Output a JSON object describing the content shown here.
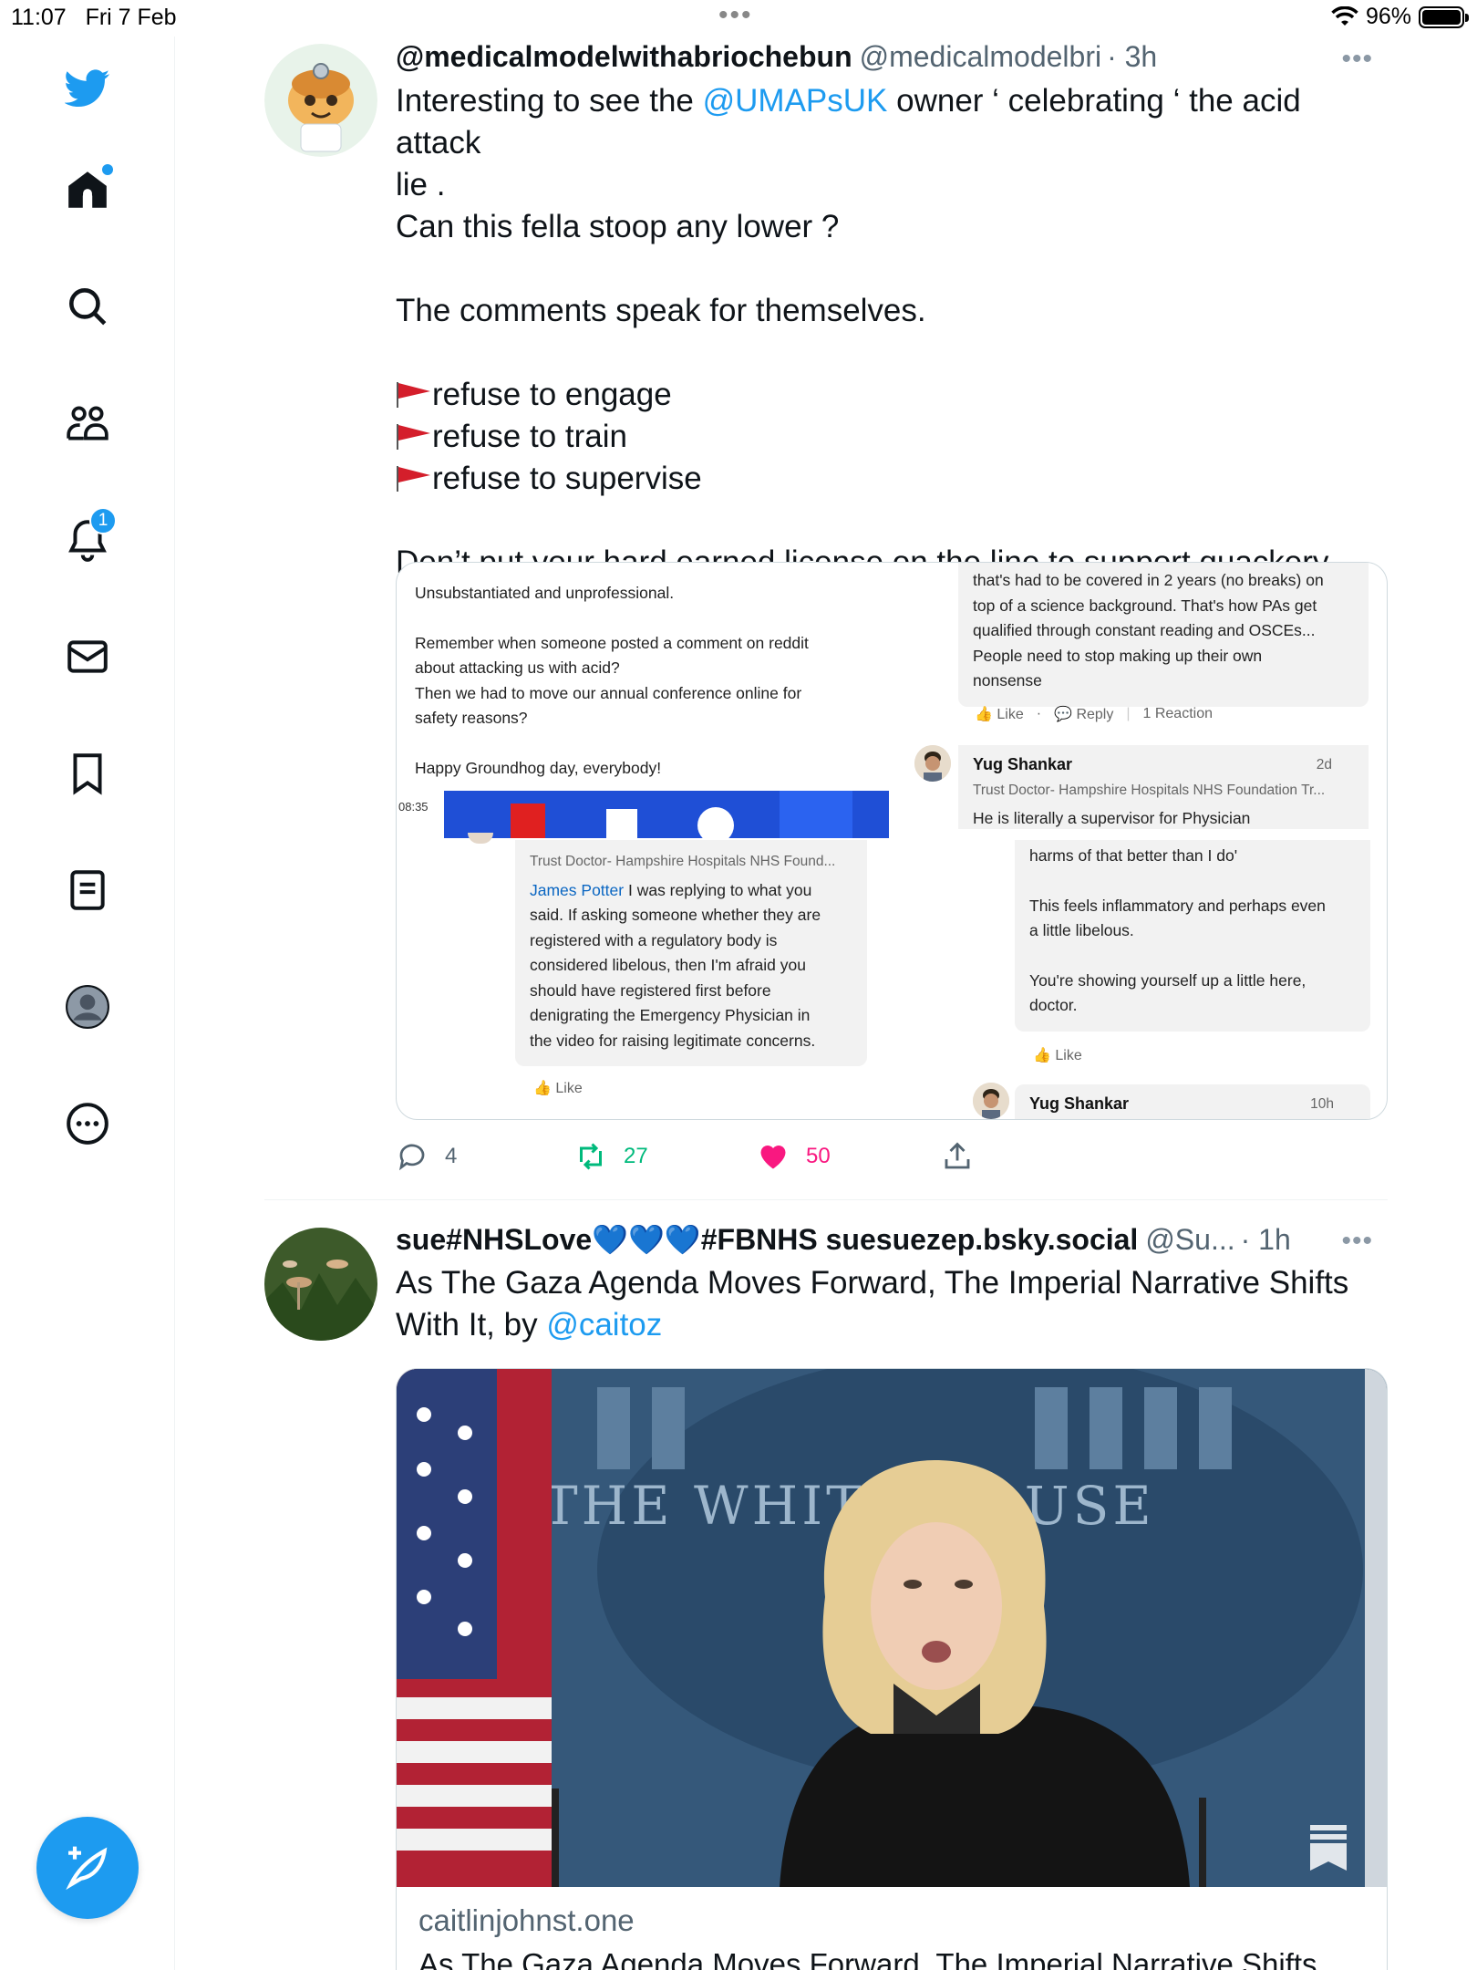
{
  "status_bar": {
    "time": "11:07",
    "date": "Fri 7 Feb",
    "battery": "96%"
  },
  "sidebar": {
    "notifications_badge": "1"
  },
  "tweets": [
    {
      "display_name": "@medicalmodelwithabriochebun",
      "handle": "@medicalmodelbri",
      "time": "· 3h",
      "text_lines": {
        "l1_pre": "Interesting to see the ",
        "l1_mention": "@UMAPsUK",
        "l1_post": " owner ‘ celebrating ‘ the acid attack",
        "l2": "lie .",
        "l3": "Can this fella stoop any lower ?",
        "l4": "The comments speak for themselves.",
        "flag1": "refuse to engage",
        "flag2": "refuse to train",
        "flag3": "refuse to supervise",
        "l5": "Don’t put your hard earned license on the line to support quackery"
      },
      "media": {
        "left_comment": {
          "p1": "Unsubstantiated and unprofessional.",
          "p2a": "Remember when someone posted a comment on reddit",
          "p2b": "about attacking us with acid?",
          "p2c": "Then we had to move our annual conference online for",
          "p2d": "safety reasons?",
          "p3": "Happy Groundhog day, everybody!",
          "video_time": "08:35"
        },
        "right_top_bubble": {
          "l1": "that's had to be covered in 2 years (no breaks) on",
          "l2": "top of a science background. That's how PAs get",
          "l3": "qualified through constant reading and OSCEs...",
          "l4": "People need to stop making up their own",
          "l5": "nonsense"
        },
        "right_top_meta": {
          "like": "Like",
          "reply": "Reply",
          "reactions": "1 Reaction"
        },
        "yug_1": {
          "name": "Yug Shankar",
          "age": "2d",
          "sub": "Trust Doctor- Hampshire Hospitals NHS Foundation Tr...",
          "text": "He is literally a supervisor for Physician"
        },
        "left_bottom_bubble": {
          "sub": "Trust Doctor- Hampshire Hospitals NHS Found...",
          "mention": "James Potter",
          "l1": " I was replying to what you",
          "l2": "said. If asking someone whether they are",
          "l3": "registered with a regulatory body is",
          "l4": "considered libelous, then I'm afraid you",
          "l5": "should have registered first before",
          "l6": "denigrating the Emergency Physician in",
          "l7": "the video for raising legitimate concerns.",
          "like": "Like"
        },
        "right_bottom_bubble": {
          "l1": "harms of that better than I do'",
          "l2": "This feels inflammatory and perhaps even",
          "l3": "a little libelous.",
          "l4": "You're showing yourself up a little here,",
          "l5": "doctor.",
          "like": "Like"
        },
        "yug_2": {
          "name": "Yug Shankar",
          "age": "10h"
        }
      },
      "actions": {
        "replies": "4",
        "retweets": "27",
        "likes": "50"
      }
    },
    {
      "display_name": "sue#NHSLove💙💙💙#FBNHS suesuezep.bsky.social",
      "handle": "@Su...",
      "time": "· 1h",
      "text_pre": "As The Gaza Agenda Moves Forward, The Imperial Narrative Shifts With It, by ",
      "text_mention": "@caitoz",
      "card": {
        "domain": "caitlinjohnst.one",
        "title": "As The Gaza Agenda Moves Forward, The Imperial Narrative Shifts",
        "sign_text": "THE WHITE HOUSE"
      }
    }
  ],
  "colors": {
    "accent": "#1d9bf0",
    "retweet": "#00ba7c",
    "like": "#f91880",
    "text_secondary": "#536471"
  }
}
